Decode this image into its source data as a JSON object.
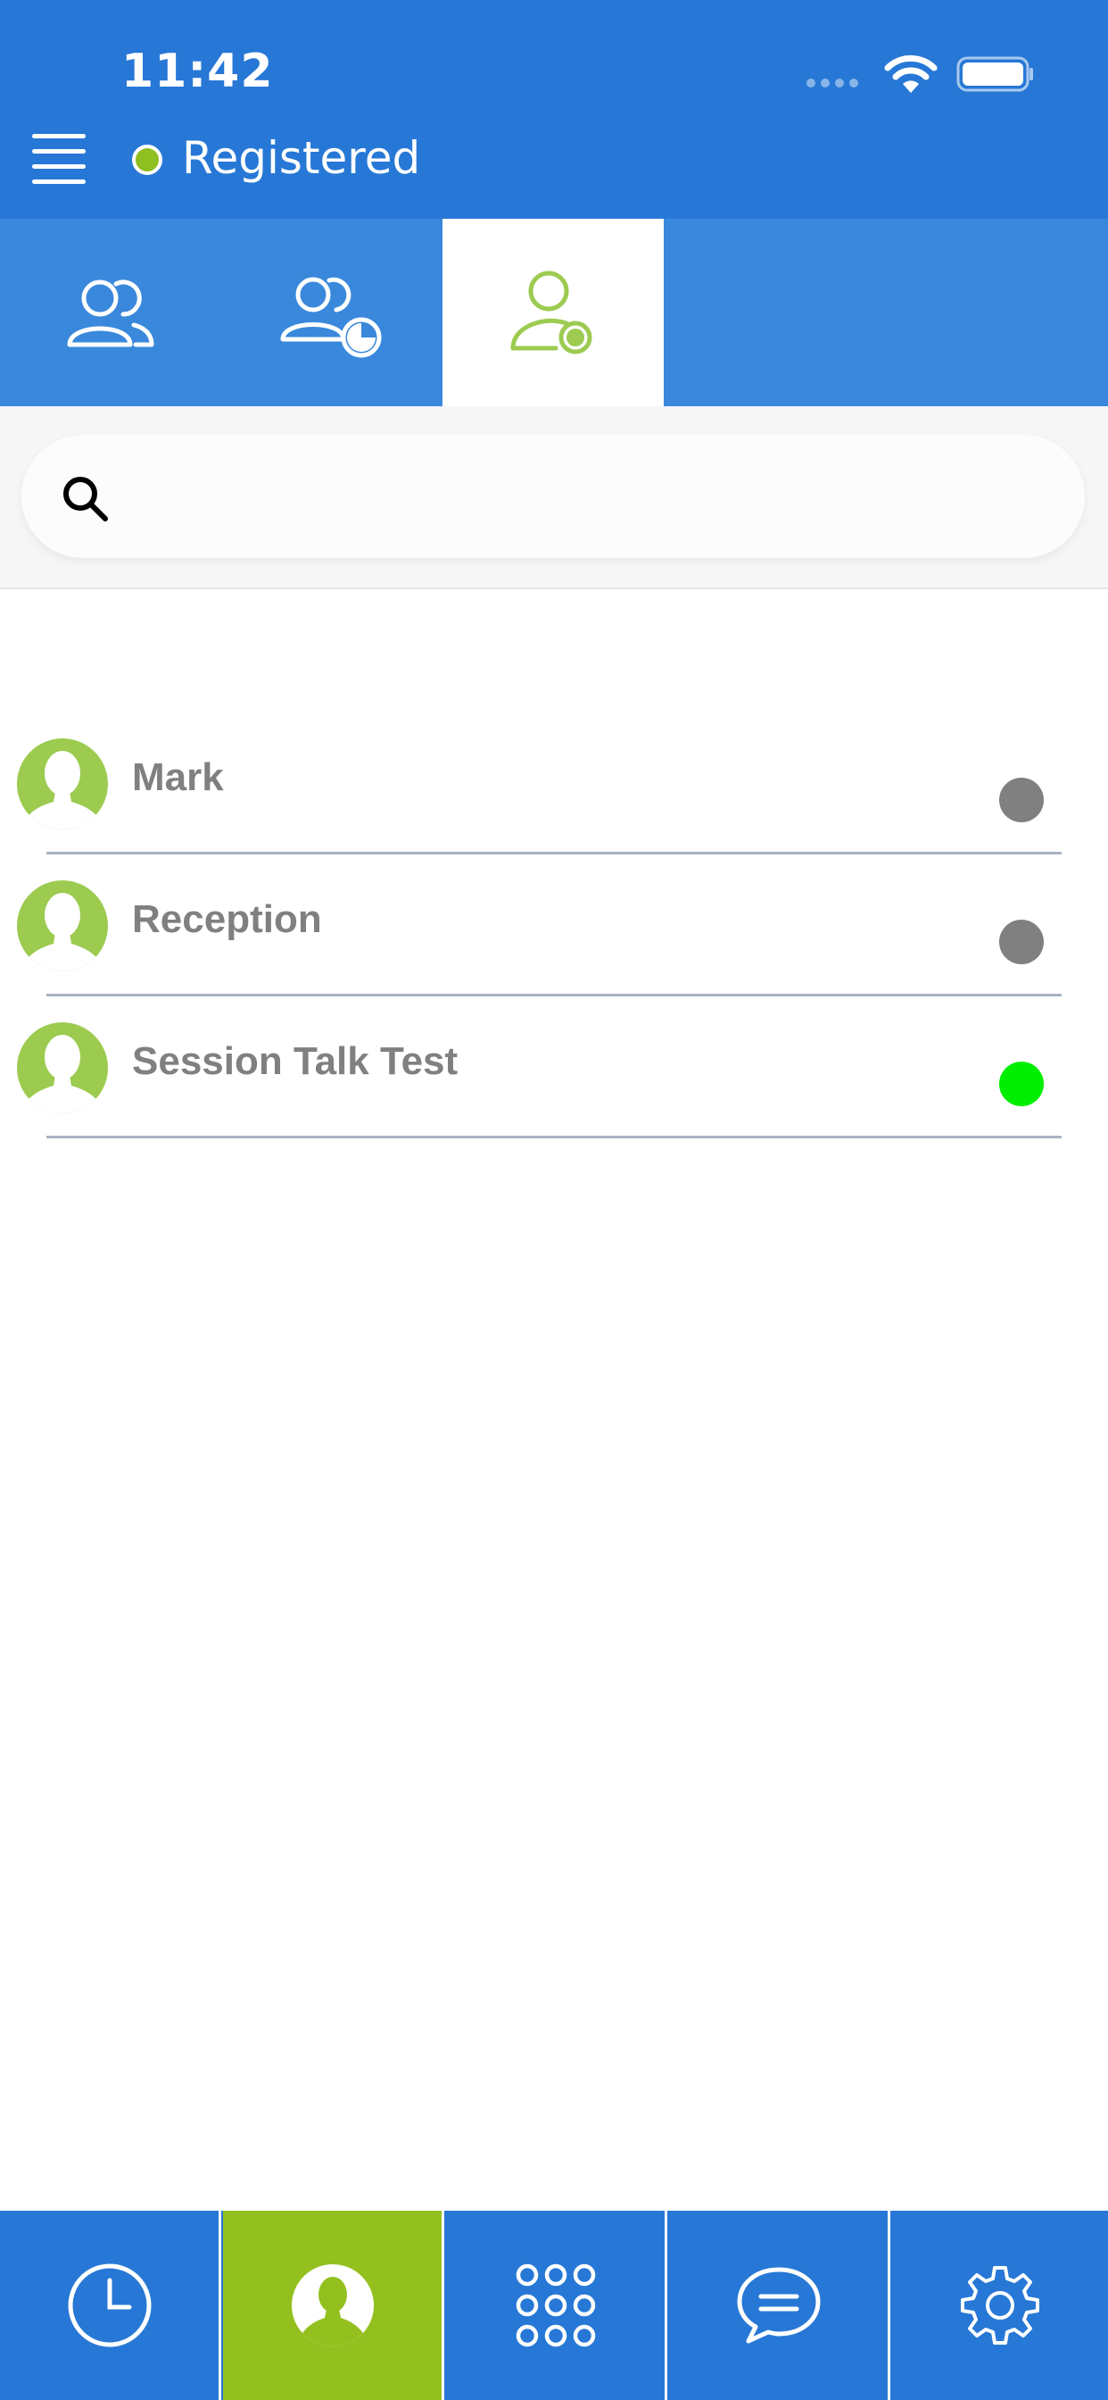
{
  "status_bar": {
    "time": "11:42",
    "icons": [
      "signal-dots-icon",
      "wifi-icon",
      "battery-icon"
    ]
  },
  "header": {
    "status_label": "Registered",
    "status_color": "#8fbf21",
    "background_color": "#2778d6",
    "menu_icon": "hamburger-menu-icon"
  },
  "tabs": [
    {
      "icon": "contacts-group-icon",
      "active": false
    },
    {
      "icon": "contacts-favorite-icon",
      "active": false
    },
    {
      "icon": "contact-presence-icon",
      "active": true
    }
  ],
  "search": {
    "placeholder": "",
    "value": "",
    "icon": "search-icon"
  },
  "contacts": [
    {
      "name": "Mark",
      "status": "offline",
      "status_color": "#808080"
    },
    {
      "name": "Reception",
      "status": "offline",
      "status_color": "#808080"
    },
    {
      "name": "Session Talk Test",
      "status": "online",
      "status_color": "#00ee00"
    }
  ],
  "bottom_nav": [
    {
      "icon": "clock-icon",
      "active": false
    },
    {
      "icon": "person-icon",
      "active": true
    },
    {
      "icon": "dialpad-icon",
      "active": false
    },
    {
      "icon": "chat-bubble-icon",
      "active": false
    },
    {
      "icon": "gear-icon",
      "active": false
    }
  ],
  "accent_color": "#93c01f"
}
